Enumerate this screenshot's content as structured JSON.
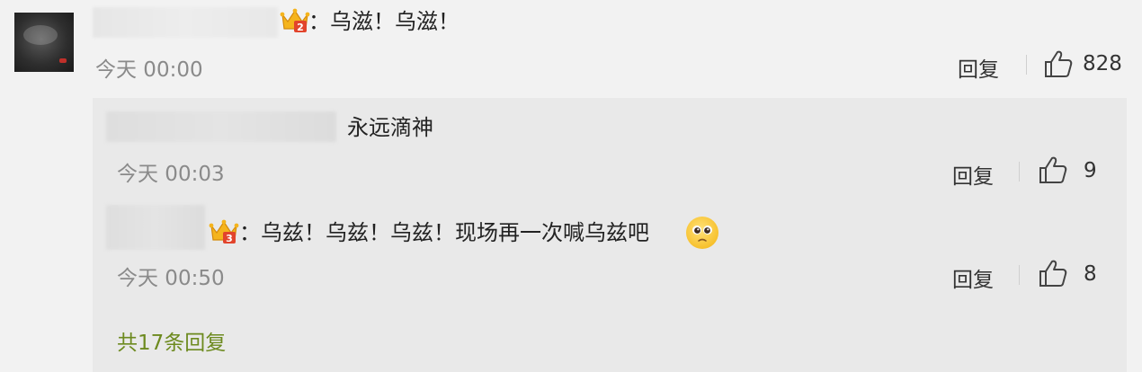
{
  "comment": {
    "text": "：乌滋！乌滋！",
    "time": "今天 00:00",
    "reply_label": "回复",
    "likes": "828",
    "badge_icon": "crown-level-2-icon"
  },
  "replies": [
    {
      "text": "永远滴神",
      "time": "今天 00:03",
      "reply_label": "回复",
      "likes": "9"
    },
    {
      "text": "：乌兹！乌兹！乌兹！现场再一次喊乌兹吧",
      "time": "今天 00:50",
      "reply_label": "回复",
      "likes": "8",
      "badge_icon": "crown-level-3-icon",
      "emoji_icon": "pleading-face-icon"
    }
  ],
  "more_replies": "共17条回复",
  "colors": {
    "background": "#f2f2f2",
    "reply_panel": "#e9e9e9",
    "link_green": "#6d8a1f",
    "muted": "#8a8a8a"
  }
}
